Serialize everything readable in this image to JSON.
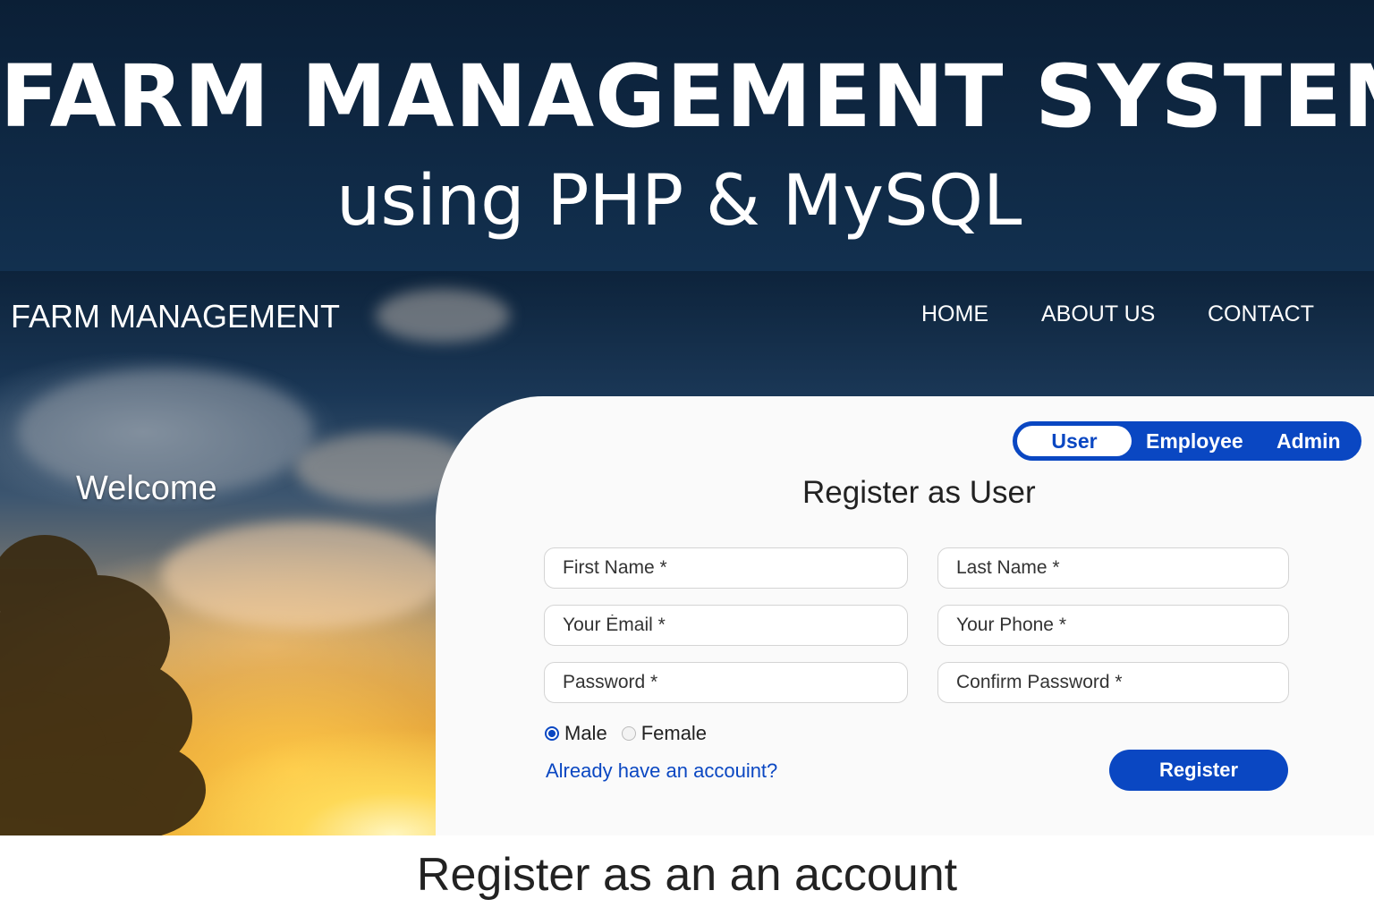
{
  "banner": {
    "title": "FARM MANAGEMENT SYSTEM",
    "subtitle": "using PHP & MySQL"
  },
  "header": {
    "brand": "FARM MANAGEMENT",
    "nav": [
      "HOME",
      "ABOUT US",
      "CONTACT"
    ]
  },
  "hero": {
    "welcome": "Welcome"
  },
  "form": {
    "tabs": [
      "User",
      "Employee",
      "Admin"
    ],
    "active_tab": "User",
    "title": "Register as User",
    "fields": {
      "first_name": "First Name *",
      "last_name": "Last Name *",
      "email": "Your Ėmail *",
      "phone": "Your Phone *",
      "password": "Password *",
      "confirm_password": "Confirm Password *"
    },
    "gender": {
      "male": "Male",
      "female": "Female",
      "selected": "Male"
    },
    "login_link": "Already have an accouint?",
    "submit": "Register"
  },
  "caption": "Register as an an account",
  "colors": {
    "accent": "#0a47c2",
    "banner": "#0b1f36"
  }
}
